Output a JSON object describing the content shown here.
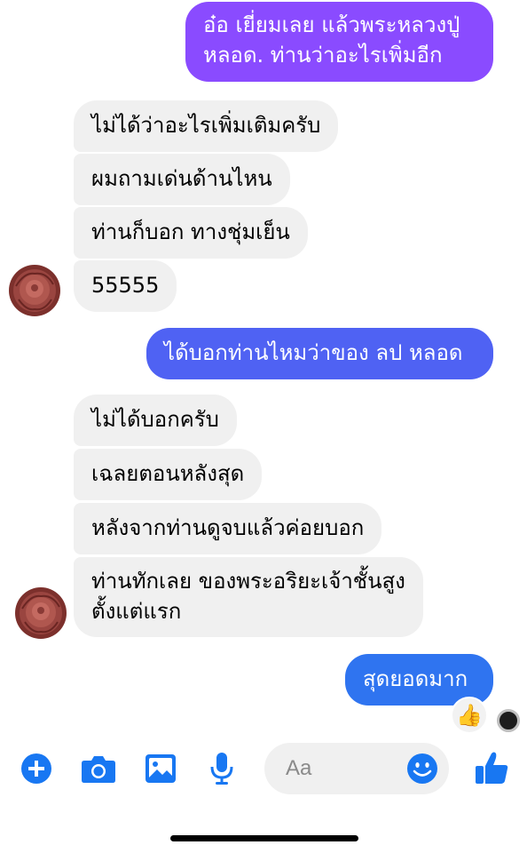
{
  "messages": [
    {
      "side": "out",
      "lines": [
        "อ๋อ เยี่ยมเลย แล้วพระหลวงปู่",
        "หลอด. ท่านว่าอะไรเพิ่มอีก"
      ]
    },
    {
      "side": "in",
      "text": "ไม่ได้ว่าอะไรเพิ่มเติมครับ"
    },
    {
      "side": "in",
      "text": "ผมถามเด่นด้านไหน"
    },
    {
      "side": "in",
      "text": "ท่านก็บอก ทางชุ่มเย็น"
    },
    {
      "side": "in",
      "text": "55555"
    },
    {
      "side": "out",
      "text": "ได้บอกท่านไหมว่าของ ลป หลอด"
    },
    {
      "side": "in",
      "text": "ไม่ได้บอกครับ"
    },
    {
      "side": "in",
      "text": "เฉลยตอนหลังสุด"
    },
    {
      "side": "in",
      "text": "หลังจากท่านดูจบแล้วค่อยบอก"
    },
    {
      "side": "in",
      "lines": [
        "ท่านทักเลย ของพระอริยะเจ้าชั้นสูง",
        "ตั้งแต่แรก"
      ]
    },
    {
      "side": "out",
      "text": "สุดยอดมาก",
      "reaction": "👍"
    }
  ],
  "composer": {
    "placeholder": "Aa"
  },
  "toolbar": {
    "icons": [
      "plus-icon",
      "camera-icon",
      "gallery-icon",
      "microphone-icon",
      "emoji-icon",
      "thumbs-up-icon"
    ]
  },
  "colors": {
    "outgoing_top": "#8a4bff",
    "outgoing_mid": "#5b5cf5",
    "outgoing_bottom": "#2f74f0",
    "incoming": "#f0f0f0",
    "accent": "#1877f2",
    "avatar_rose": "#8e3b37"
  }
}
